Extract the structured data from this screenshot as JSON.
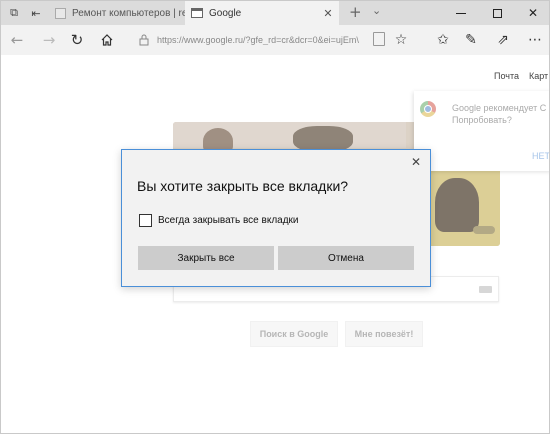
{
  "titlebar": {
    "tabs": [
      {
        "label": "Ремонт компьютеров | rem"
      },
      {
        "label": "Google"
      }
    ],
    "new_tab_label": "+",
    "tab_menu_label": "⌄"
  },
  "navbar": {
    "url": "https://www.google.ru/?gfe_rd=cr&dcr=0&ei=ujEm\\"
  },
  "page": {
    "header_links": {
      "mail": "Почта",
      "maps": "Карт"
    },
    "chrome_promo": {
      "line1": "Google рекомендует C",
      "line2": "Попробовать?",
      "no_label": "НЕТ"
    },
    "buttons": {
      "search": "Поиск в Google",
      "lucky": "Мне повезёт!"
    }
  },
  "dialog": {
    "title": "Вы хотите закрыть все вкладки?",
    "checkbox_label": "Всегда закрывать все вкладки",
    "checkbox_checked": false,
    "close_all_label": "Закрыть все",
    "cancel_label": "Отмена",
    "accent_color": "#4a8fd8"
  }
}
